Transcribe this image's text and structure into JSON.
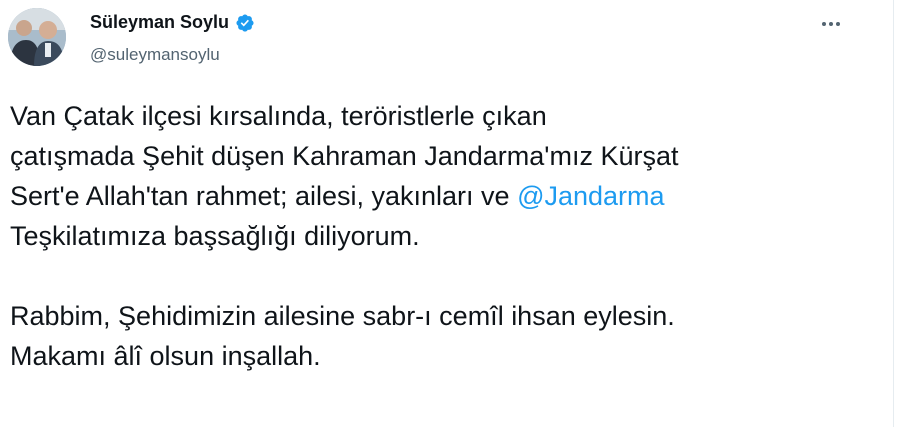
{
  "user": {
    "display_name": "Süleyman Soylu",
    "handle": "@suleymansoylu",
    "verified_icon": "verified-badge-icon",
    "avatar": "profile-photo"
  },
  "header": {
    "more_icon": "more-horizontal-icon"
  },
  "tweet": {
    "line1": "Van Çatak ilçesi kırsalında, teröristlerle çıkan",
    "line2": "çatışmada Şehit düşen Kahraman Jandarma'mız Kürşat",
    "line3_before_mention": "Sert'e Allah'tan rahmet; ailesi, yakınları ve ",
    "mention": "@Jandarma",
    "line4": "Teşkilatımıza başsağlığı diliyorum.",
    "line5": "Rabbim, Şehidimizin ailesine sabr-ı cemîl ihsan eylesin.",
    "line6": "Makamı âlî olsun inşallah."
  },
  "colors": {
    "text": "#0f1419",
    "secondary": "#536471",
    "link": "#1d9bf0",
    "verified": "#1d9bf0"
  }
}
